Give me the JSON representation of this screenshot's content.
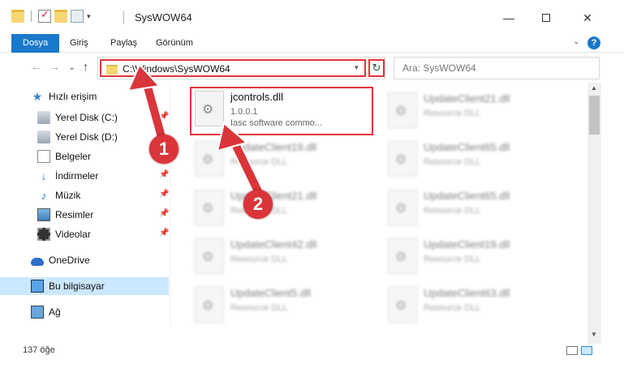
{
  "window": {
    "title": "SysWOW64",
    "buttons": {
      "minimize": "—",
      "close": "✕"
    }
  },
  "ribbon": {
    "tabs": [
      "Dosya",
      "Giriş",
      "Paylaş",
      "Görünüm"
    ],
    "active_tab": "Dosya",
    "help": "?",
    "accent_color": "#1979ca"
  },
  "address": {
    "path": "C:\\Windows\\SysWOW64",
    "refresh": "↻",
    "search_placeholder": "Ara: SysWOW64"
  },
  "nav": {
    "back": "←",
    "forward": "→",
    "recent": "⌄",
    "up": "↑"
  },
  "sidebar": {
    "items": [
      {
        "label": "Hızlı erişim",
        "icon": "star-icon",
        "pinned": false
      },
      {
        "label": "Yerel Disk (C:)",
        "icon": "disk-icon",
        "pinned": true
      },
      {
        "label": "Yerel Disk (D:)",
        "icon": "disk-icon",
        "pinned": false
      },
      {
        "label": "Belgeler",
        "icon": "document-icon",
        "pinned": true
      },
      {
        "label": "İndirmeler",
        "icon": "download-icon",
        "pinned": true
      },
      {
        "label": "Müzik",
        "icon": "music-icon",
        "pinned": true
      },
      {
        "label": "Resimler",
        "icon": "pictures-icon",
        "pinned": true
      },
      {
        "label": "Videolar",
        "icon": "videos-icon",
        "pinned": true
      },
      {
        "label": "OneDrive",
        "icon": "cloud-icon",
        "pinned": false
      },
      {
        "label": "Bu bilgisayar",
        "icon": "computer-icon",
        "pinned": false,
        "selected": true
      },
      {
        "label": "Ağ",
        "icon": "network-icon",
        "pinned": false
      }
    ]
  },
  "files": {
    "highlighted": {
      "name": "jcontrols.dll",
      "version": "1.0.0.1",
      "description": "Iasc software commo..."
    },
    "blurred": [
      {
        "name": "UpdateClient21.dll",
        "desc": "Resource DLL"
      },
      {
        "name": "UpdateClient19.dll",
        "desc": "Resource DLL"
      },
      {
        "name": "UpdateClient65.dll",
        "desc": "Resource DLL"
      },
      {
        "name": "UpdateClient21.dll",
        "desc": "Resource DLL"
      },
      {
        "name": "UpdateClient65.dll",
        "desc": "Resource DLL"
      },
      {
        "name": "UpdateClient42.dll",
        "desc": "Resource DLL"
      },
      {
        "name": "UpdateClient19.dll",
        "desc": "Resource DLL"
      },
      {
        "name": "UpdateClient5.dll",
        "desc": "Resource DLL"
      },
      {
        "name": "UpdateClient63.dll",
        "desc": "Resource DLL"
      }
    ]
  },
  "status": {
    "count": "137 öğe"
  },
  "annotations": {
    "badge1": "1",
    "badge2": "2",
    "color": "#d9353b"
  }
}
